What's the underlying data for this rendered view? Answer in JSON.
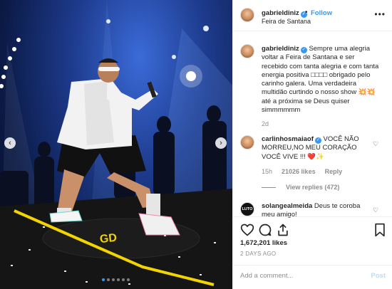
{
  "post": {
    "username": "gabrieldiniz",
    "follow_label": "Follow",
    "separator": "•",
    "location": "Feira de Santana",
    "more_label": "•••"
  },
  "caption": {
    "username": "gabrieldiniz",
    "text": "Sempre uma alegria voltar a Feira de Santana e ser recebido com tanta alegria e com tanta energia positiva □□□□ obrigado pelo carinho galera. Uma verdadeira multidão curtindo o nosso show 💥💥 até a próxima se Deus quiser simmmmmm",
    "time": "2d"
  },
  "comments": [
    {
      "username": "carlinhosmaiaof",
      "text": "VOCÊ NÃO MORREU,NO MEU CORAÇÃO VOCÊ VIVE !!! ❤️✨",
      "time": "15h",
      "likes": "21026 likes",
      "reply_label": "Reply",
      "view_replies": "View replies (472)"
    },
    {
      "username": "solangealmeida",
      "avatar_text": "LUTO",
      "text": "Deus te coroba meu amigo!"
    }
  ],
  "stats": {
    "likes": "1,672,201 likes",
    "date": "2 DAYS AGO"
  },
  "add_comment": {
    "placeholder": "Add a comment...",
    "post_label": "Post"
  },
  "nav": {
    "prev_symbol": "‹",
    "next_symbol": "›"
  },
  "carousel": {
    "count": 6,
    "active_index": 0
  },
  "colors": {
    "accent": "#3897f0",
    "stage_blue": "#1d3a8c",
    "stage_yellow": "#f2d400"
  }
}
